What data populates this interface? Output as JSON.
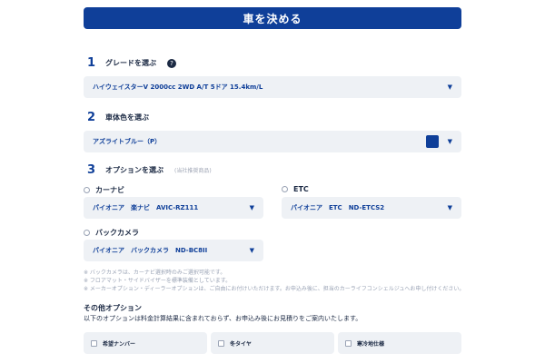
{
  "header": {
    "title": "車を決める"
  },
  "steps": [
    {
      "num": "1",
      "title": "グレードを選ぶ",
      "help": "?"
    },
    {
      "num": "2",
      "title": "車体色を選ぶ"
    },
    {
      "num": "3",
      "title": "オプションを選ぶ",
      "note": "(当社推奨商品)"
    }
  ],
  "grade": {
    "selected": "ハイウェイスターV 2000cc 2WD A/T 5ドア 15.4km/L"
  },
  "body_color": {
    "selected": "アズライトブルー（P）",
    "swatch_color": "#0f3f99"
  },
  "options": {
    "car_navi": {
      "label": "カーナビ",
      "selected": "パイオニア　楽ナビ　AVIC-RZ111"
    },
    "etc": {
      "label": "ETC",
      "selected": "パイオニア　ETC　ND-ETCS2"
    },
    "back_camera": {
      "label": "バックカメラ",
      "selected": "パイオニア　バックカメラ　ND-BC8II"
    }
  },
  "notes": [
    "※ バックカメラは、カーナビ選択時のみご選択可能です。",
    "※ フロアマット・サイドバイザーを標準装備としています。",
    "※ メーカーオプション・ディーラーオプションは、ご自由にお付けいただけます。お申込み後に、担当のカーライフコンシェルジュへお申し付けください。"
  ],
  "other": {
    "title": "その他オプション",
    "desc": "以下のオプションは料金計算結果に含まれておらず、お申込み後にお見積りをご案内いたします。",
    "items": [
      "希望ナンバー",
      "冬タイヤ",
      "寒冷地仕様"
    ]
  },
  "icons": {
    "caret": "▼"
  }
}
